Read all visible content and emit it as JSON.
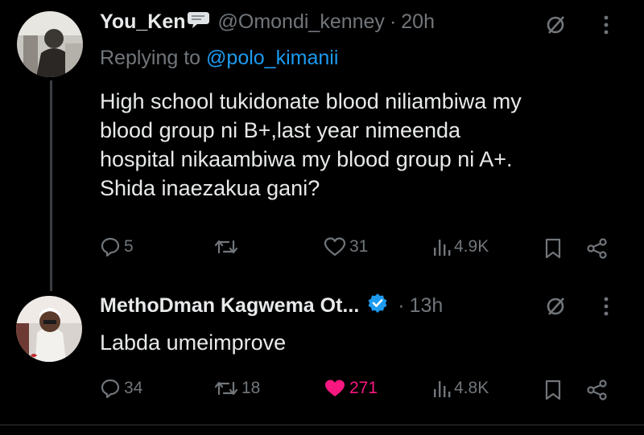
{
  "original_tweet": {
    "display_name": "You_Ken",
    "handle": "@Omondi_kenney",
    "separator": "·",
    "time": "20h",
    "replying_prefix": "Replying to",
    "replying_handle": "@polo_kimanii",
    "text_lines": [
      "High school tukidonate blood niliambiwa my",
      "blood group ni B+,last year nimeenda",
      "hospital nikaambiwa my blood group ni A+.",
      "Shida inaezakua gani?"
    ],
    "replies": "5",
    "retweets": "",
    "likes": "31",
    "views": "4.9K"
  },
  "reply_tweet": {
    "display_name": "MethoDman Kagwema Ot...",
    "separator": "·",
    "time": "13h",
    "text": "Labda umeimprove",
    "replies": "34",
    "retweets": "18",
    "likes": "271",
    "views": "4.8K",
    "liked": true
  },
  "colors": {
    "background": "#000000",
    "text": "#e7e9ea",
    "muted": "#71767b",
    "link": "#1d9bf0",
    "verified": "#1d9bf0",
    "like_active": "#f91880"
  },
  "icons": [
    "speech-balloon-emoji",
    "grok-icon",
    "more-icon",
    "reply-icon",
    "retweet-icon",
    "like-icon",
    "views-icon",
    "bookmark-icon",
    "share-icon",
    "verified-badge-icon"
  ]
}
